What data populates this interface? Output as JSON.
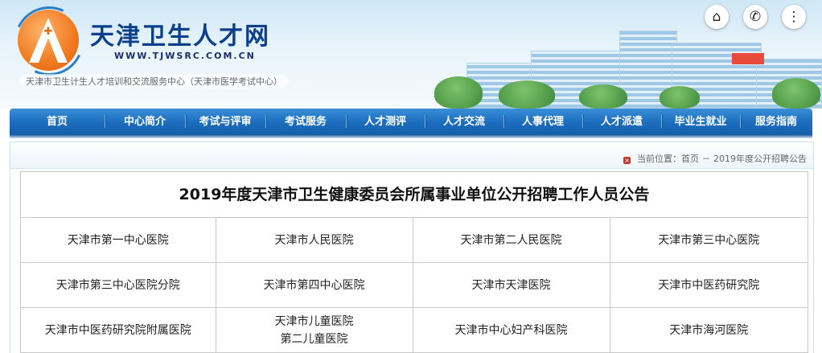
{
  "header": {
    "title": "天津卫生人才网",
    "url": "WWW.TJWSRC.COM.CN",
    "subtitle": "天津市卫生计生人才培训和交流服务中心（天津市医学考试中心）",
    "buttons": [
      {
        "icon": "home-icon"
      },
      {
        "icon": "phone-icon"
      },
      {
        "icon": "sitemap-icon"
      }
    ]
  },
  "nav": {
    "items": [
      "首页",
      "中心简介",
      "考试与评审",
      "考试服务",
      "人才测评",
      "人才交流",
      "人事代理",
      "人才派遣",
      "毕业生就业",
      "服务指南"
    ]
  },
  "breadcrumb": {
    "label": "当前位置：首页 － 2019年度公开招聘公告"
  },
  "announcement": {
    "title": "2019年度天津市卫生健康委员会所属事业单位公开招聘工作人员公告",
    "rows": [
      [
        {
          "lines": [
            "天津市第一中心医院"
          ]
        },
        {
          "lines": [
            "天津市人民医院"
          ]
        },
        {
          "lines": [
            "天津市第二人民医院"
          ]
        },
        {
          "lines": [
            "天津市第三中心医院"
          ]
        }
      ],
      [
        {
          "lines": [
            "天津市第三中心医院分院"
          ]
        },
        {
          "lines": [
            "天津市第四中心医院"
          ]
        },
        {
          "lines": [
            "天津市天津医院"
          ]
        },
        {
          "lines": [
            "天津市中医药研究院"
          ]
        }
      ],
      [
        {
          "lines": [
            "天津市中医药研究院附属医院"
          ]
        },
        {
          "lines": [
            "天津市儿童医院",
            "第二儿童医院"
          ]
        },
        {
          "lines": [
            "天津市中心妇产科医院"
          ]
        },
        {
          "lines": [
            "天津市海河医院"
          ]
        }
      ]
    ]
  },
  "colors": {
    "nav_blue": "#1d6fc0",
    "title_blue": "#0d3f8a",
    "logo_orange": "#f07a1f"
  }
}
